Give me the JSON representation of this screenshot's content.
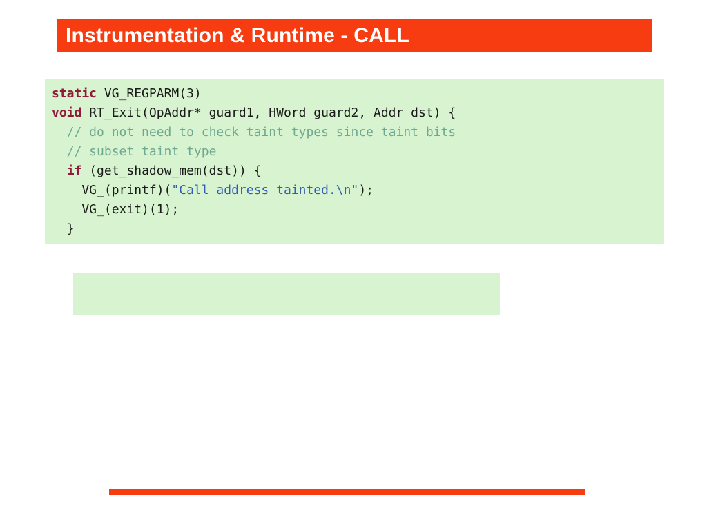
{
  "title": "Instrumentation & Runtime - CALL",
  "code": {
    "kw_static": "static",
    "after_static": " VG_REGPARM(3)",
    "kw_void": "void",
    "after_void": " RT_Exit(OpAddr* guard1, HWord guard2, Addr dst) {",
    "cmt1": "  // do not need to check taint types since taint bits",
    "cmt2": "  // subset taint type",
    "indent_if": "  ",
    "kw_if": "if",
    "after_if": " (get_shadow_mem(dst)) {",
    "printf_pre": "    VG_(printf)(",
    "printf_str": "\"Call address tainted.\\n\"",
    "printf_post": ");",
    "exit_line": "    VG_(exit)(1);",
    "close_brace": "  }"
  },
  "colors": {
    "accent": "#f63c10",
    "code_bg": "#d8f3cf"
  }
}
